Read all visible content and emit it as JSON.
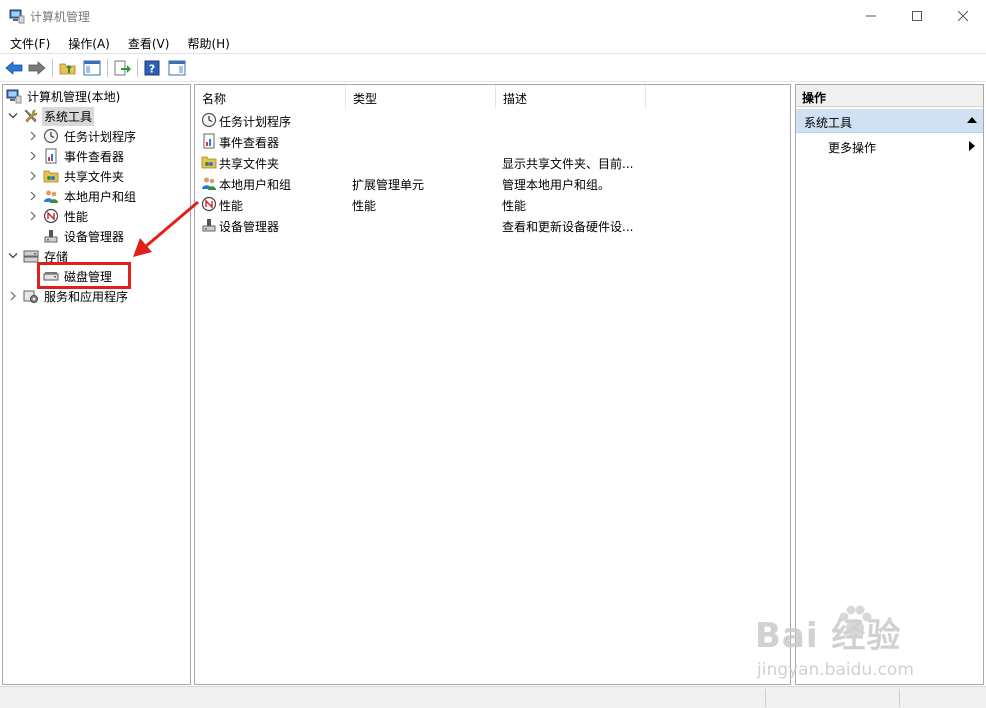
{
  "window": {
    "title": "计算机管理",
    "icon": "computer-management-icon"
  },
  "menubar": [
    {
      "label": "文件(F)"
    },
    {
      "label": "操作(A)"
    },
    {
      "label": "查看(V)"
    },
    {
      "label": "帮助(H)"
    }
  ],
  "toolbar": {
    "icons": [
      "back-arrow-icon",
      "forward-arrow-icon",
      "up-folder-icon",
      "show-hide-tree-icon",
      "export-list-icon",
      "help-icon",
      "show-hide-action-pane-icon"
    ]
  },
  "tree": {
    "root": {
      "label": "计算机管理(本地)",
      "icon": "computer-management-icon"
    },
    "system_tools": {
      "label": "系统工具",
      "icon": "tools-icon",
      "selected": true
    },
    "system_children": [
      {
        "label": "任务计划程序",
        "icon": "clock-icon"
      },
      {
        "label": "事件查看器",
        "icon": "event-viewer-icon"
      },
      {
        "label": "共享文件夹",
        "icon": "shared-folder-icon"
      },
      {
        "label": "本地用户和组",
        "icon": "users-icon"
      },
      {
        "label": "性能",
        "icon": "performance-icon"
      },
      {
        "label": "设备管理器",
        "icon": "device-manager-icon"
      }
    ],
    "storage": {
      "label": "存储",
      "icon": "storage-icon"
    },
    "disk_management": {
      "label": "磁盘管理",
      "icon": "disk-icon"
    },
    "services": {
      "label": "服务和应用程序",
      "icon": "services-icon"
    }
  },
  "list": {
    "columns": [
      "名称",
      "类型",
      "描述"
    ],
    "rows": [
      {
        "name": "任务计划程序",
        "type": "",
        "desc": "",
        "icon": "clock-icon"
      },
      {
        "name": "事件查看器",
        "type": "",
        "desc": "",
        "icon": "event-viewer-icon"
      },
      {
        "name": "共享文件夹",
        "type": "",
        "desc": "显示共享文件夹、目前...",
        "icon": "shared-folder-icon"
      },
      {
        "name": "本地用户和组",
        "type": "扩展管理单元",
        "desc": "管理本地用户和组。",
        "icon": "users-icon"
      },
      {
        "name": "性能",
        "type": "性能",
        "desc": "性能",
        "icon": "performance-icon"
      },
      {
        "name": "设备管理器",
        "type": "",
        "desc": "查看和更新设备硬件设...",
        "icon": "device-manager-icon"
      }
    ]
  },
  "actions": {
    "header": "操作",
    "group": "系统工具",
    "more": "更多操作"
  },
  "watermark": {
    "main": "Bai  经验",
    "sub": "jingyan.baidu.com"
  },
  "colors": {
    "annotation_red": "#e0211b",
    "action_group_bg": "#cfe1f3",
    "selected_bg": "#d9d9d9"
  }
}
